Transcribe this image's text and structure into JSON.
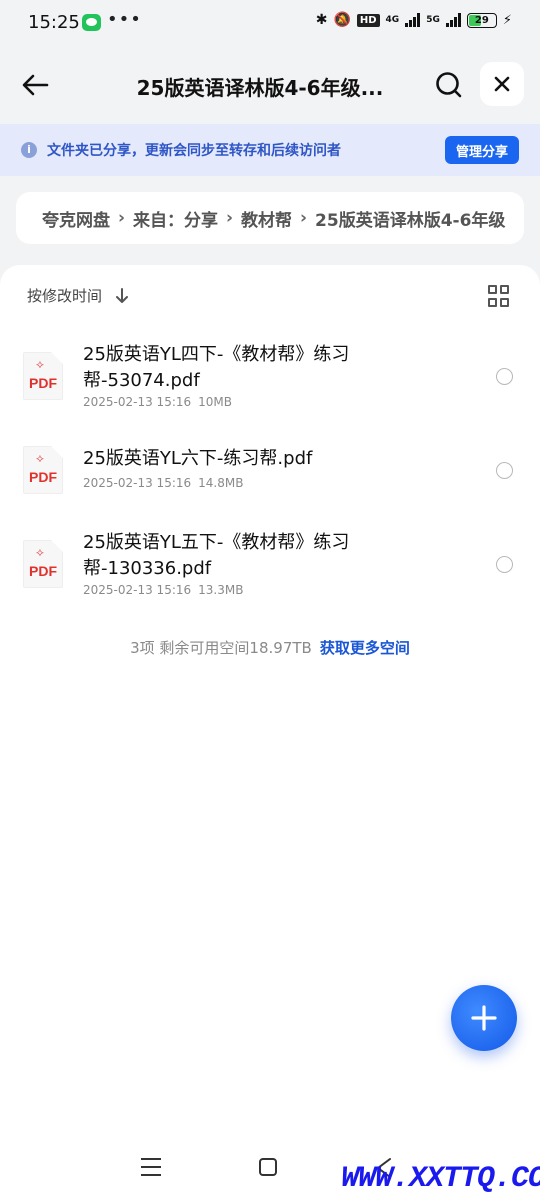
{
  "status_bar": {
    "time": "15:25",
    "hd_label": "HD",
    "net_4g": "4G",
    "net_5g": "5G",
    "battery": "29"
  },
  "header": {
    "title": "25版英语译林版4-6年级..."
  },
  "notice": {
    "text": "文件夹已分享，更新会同步至转存和后续访问者",
    "manage_button": "管理分享"
  },
  "breadcrumb": [
    "夸克网盘",
    "来自：分享",
    "教材帮",
    "25版英语译林版4-6年级"
  ],
  "list": {
    "sort_label": "按修改时间",
    "files": [
      {
        "name": "25版英语YL四下-《教材帮》练习帮-53074.pdf",
        "date": "2025-02-13 15:16",
        "size": "10MB"
      },
      {
        "name": "25版英语YL六下-练习帮.pdf",
        "date": "2025-02-13 15:16",
        "size": "14.8MB"
      },
      {
        "name": "25版英语YL五下-《教材帮》练习帮-130336.pdf",
        "date": "2025-02-13 15:16",
        "size": "13.3MB"
      }
    ],
    "file_icon_label": "PDF"
  },
  "footer": {
    "summary": "3项 剩余可用空间18.97TB",
    "get_more": "获取更多空间"
  },
  "watermark": "WWW.XXTTQ.COM",
  "colors": {
    "accent": "#1a66f0",
    "notice_bg": "#e4eafb",
    "pdf_red": "#e0322c"
  }
}
